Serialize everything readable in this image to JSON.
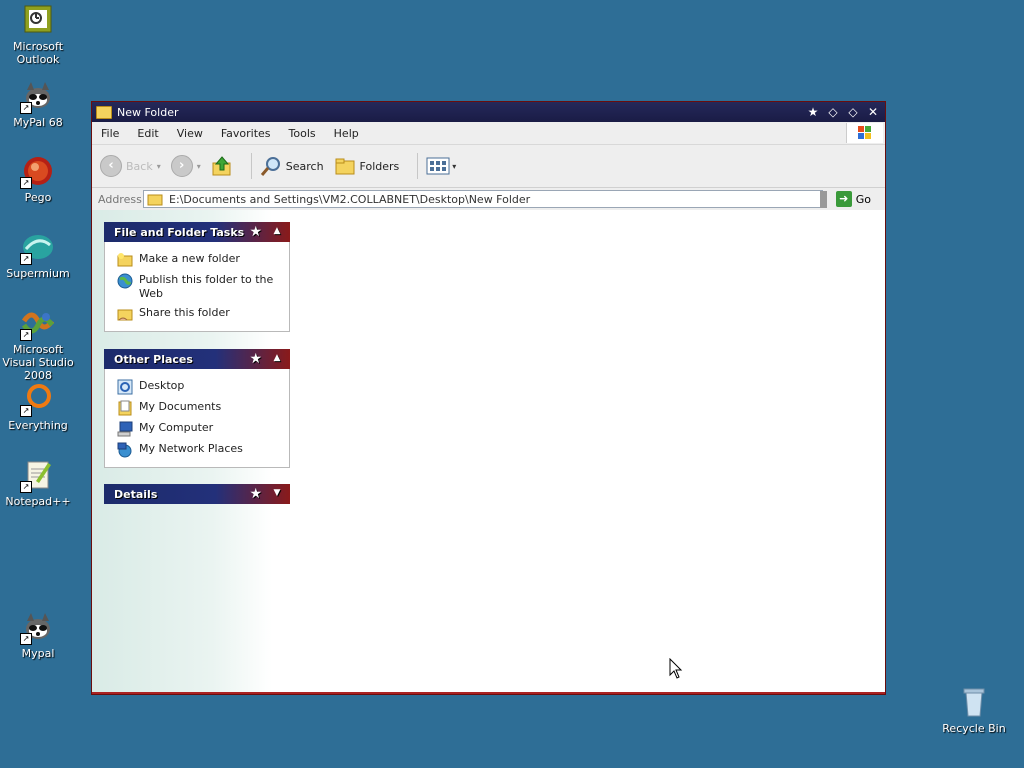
{
  "desktop": {
    "icons": [
      {
        "label": "Microsoft Outlook"
      },
      {
        "label": "MyPal 68"
      },
      {
        "label": "Pego"
      },
      {
        "label": "Supermium"
      },
      {
        "label": "Microsoft Visual Studio 2008"
      },
      {
        "label": "Everything"
      },
      {
        "label": "Notepad++"
      },
      {
        "label": "Mypal"
      },
      {
        "label": "Recycle Bin"
      }
    ]
  },
  "window": {
    "title": "New Folder",
    "menu": [
      "File",
      "Edit",
      "View",
      "Favorites",
      "Tools",
      "Help"
    ],
    "toolbar": {
      "back_label": "Back",
      "search_label": "Search",
      "folders_label": "Folders"
    },
    "address": {
      "label": "Address",
      "value": "E:\\Documents and Settings\\VM2.COLLABNET\\Desktop\\New Folder",
      "go_label": "Go"
    },
    "panels": {
      "file_tasks": {
        "title": "File and Folder Tasks",
        "items": [
          {
            "label": "Make a new folder",
            "icon": "new-folder-icon"
          },
          {
            "label": "Publish this folder to the Web",
            "icon": "globe-icon"
          },
          {
            "label": "Share this folder",
            "icon": "share-folder-icon"
          }
        ]
      },
      "other_places": {
        "title": "Other Places",
        "items": [
          {
            "label": "Desktop",
            "icon": "desktop-icon"
          },
          {
            "label": "My Documents",
            "icon": "my-documents-icon"
          },
          {
            "label": "My Computer",
            "icon": "my-computer-icon"
          },
          {
            "label": "My Network Places",
            "icon": "network-places-icon"
          }
        ]
      },
      "details": {
        "title": "Details"
      }
    }
  }
}
